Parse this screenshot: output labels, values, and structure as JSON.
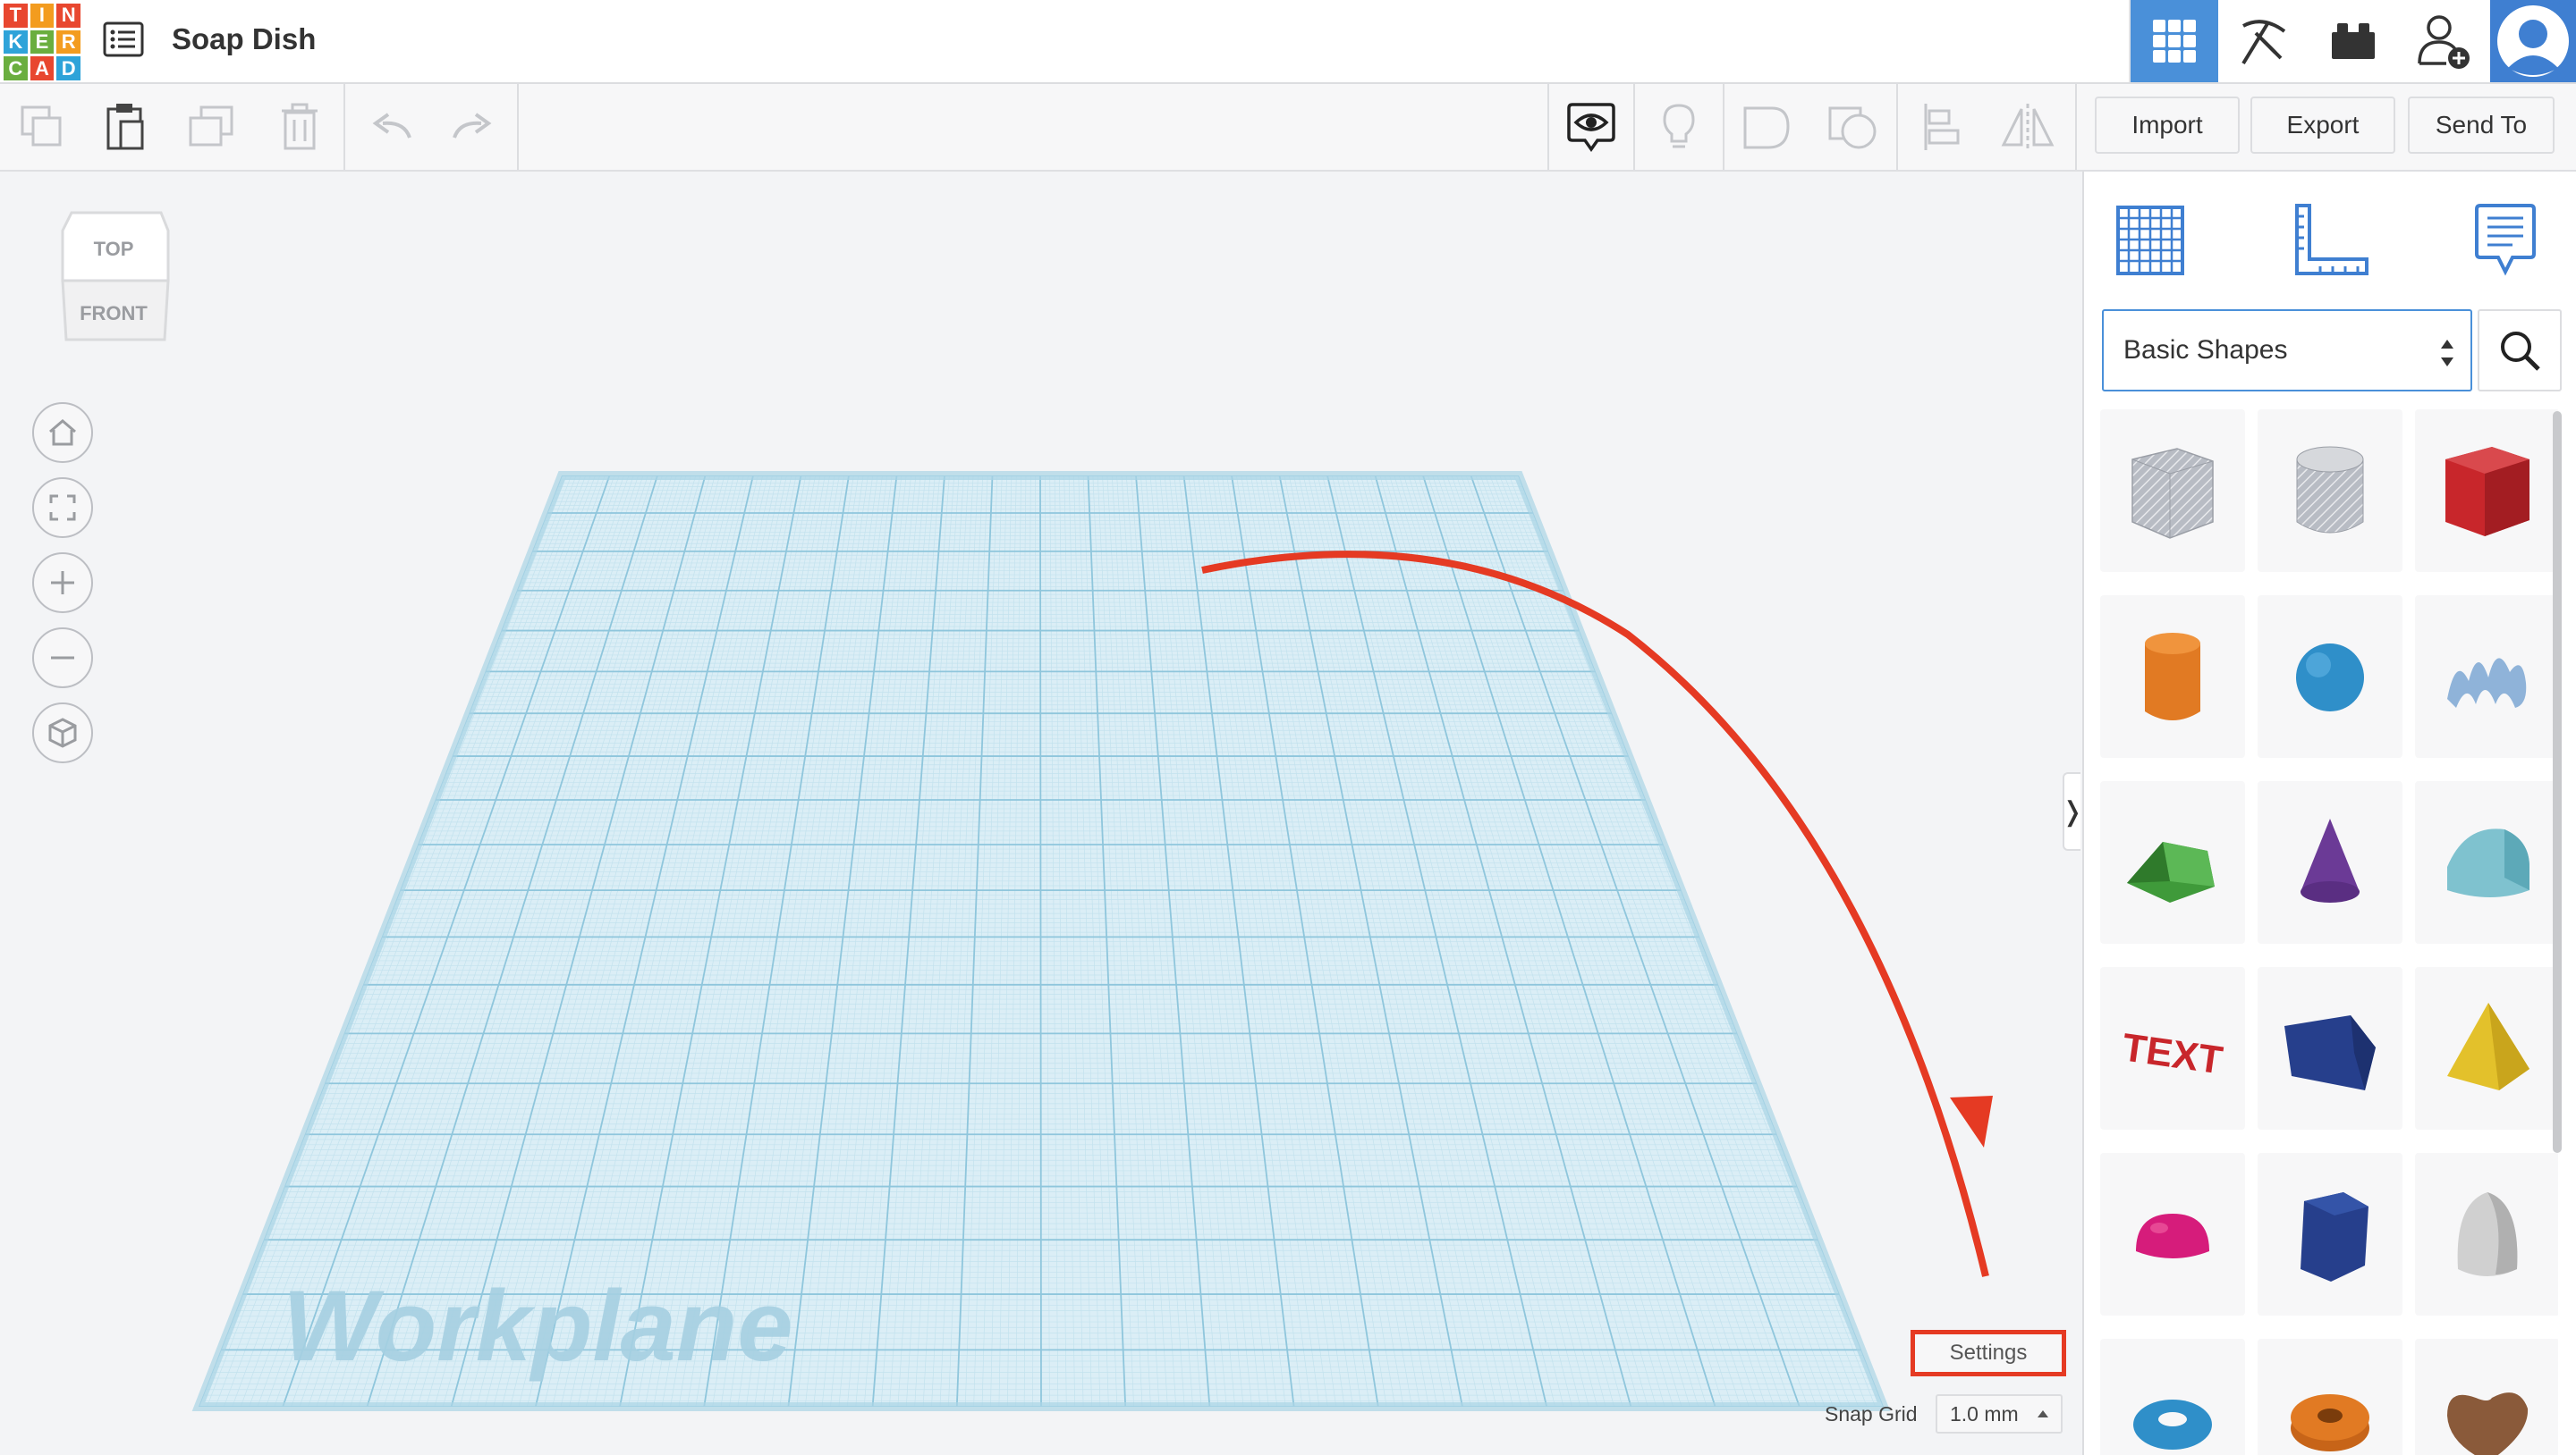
{
  "app": {
    "logo_letters": [
      "T",
      "I",
      "N",
      "K",
      "E",
      "R",
      "C",
      "A",
      "D"
    ],
    "logo_colors": [
      "#e8472f",
      "#f39c1f",
      "#e8472f",
      "#2ea3d9",
      "#6aae3f",
      "#f39c1f",
      "#6aae3f",
      "#e8472f",
      "#2ea3d9"
    ],
    "design_title": "Soap Dish",
    "accent_color": "#4a90d9"
  },
  "topbar": {
    "design_list_icon": "list-icon",
    "buttons": [
      {
        "name": "3d-view",
        "icon": "grid-icon",
        "active": true
      },
      {
        "name": "build",
        "icon": "pickaxe-icon",
        "active": false
      },
      {
        "name": "bricks",
        "icon": "brick-icon",
        "active": false
      },
      {
        "name": "add-user",
        "icon": "add-user-icon",
        "active": false
      }
    ],
    "avatar_icon": "user-avatar-icon"
  },
  "toolbar": {
    "left_icons": [
      "copy-icon",
      "paste-icon",
      "duplicate-icon",
      "delete-icon",
      "undo-icon",
      "redo-icon"
    ],
    "right_icons": [
      "show-all-icon",
      "notes-light-icon",
      "group-icon",
      "ungroup-icon",
      "align-icon",
      "mirror-icon"
    ],
    "import_label": "Import",
    "export_label": "Export",
    "send_to_label": "Send To"
  },
  "viewport": {
    "viewcube": {
      "top_label": "TOP",
      "front_label": "FRONT"
    },
    "nav_icons": [
      "home-icon",
      "fit-view-icon",
      "zoom-in-icon",
      "zoom-out-icon",
      "perspective-icon"
    ],
    "workplane_label": "Workplane",
    "settings_label": "Settings",
    "snap_grid_label": "Snap Grid",
    "snap_grid_value": "1.0 mm",
    "annotation_color": "#e53a23",
    "grid_color": "#a9d4e6"
  },
  "right_panel": {
    "tabs": [
      "workplane-tool-icon",
      "ruler-icon",
      "notes-icon"
    ],
    "library_select_value": "Basic Shapes",
    "search_icon": "search-icon",
    "shapes": [
      {
        "name": "box-hole",
        "color": "#b8bcc4"
      },
      {
        "name": "cylinder-hole",
        "color": "#b8bcc4"
      },
      {
        "name": "box",
        "color": "#c8262b"
      },
      {
        "name": "cylinder",
        "color": "#e17a23"
      },
      {
        "name": "sphere",
        "color": "#2f8fc9"
      },
      {
        "name": "scribble",
        "color": "#8fb3d9"
      },
      {
        "name": "roof",
        "color": "#3f9a3a"
      },
      {
        "name": "cone",
        "color": "#6b3a96"
      },
      {
        "name": "round-roof",
        "color": "#7fc2cf"
      },
      {
        "name": "text",
        "color": "#c8262b"
      },
      {
        "name": "polygon",
        "color": "#263f8c"
      },
      {
        "name": "pyramid",
        "color": "#e3c12b"
      },
      {
        "name": "half-sphere",
        "color": "#d61c7b"
      },
      {
        "name": "hexagonal-prism",
        "color": "#263f8c"
      },
      {
        "name": "paraboloid",
        "color": "#d0d0d0"
      },
      {
        "name": "torus",
        "color": "#2f8fc9"
      },
      {
        "name": "tube",
        "color": "#e17a23"
      },
      {
        "name": "heart",
        "color": "#8a5a3a"
      }
    ]
  }
}
